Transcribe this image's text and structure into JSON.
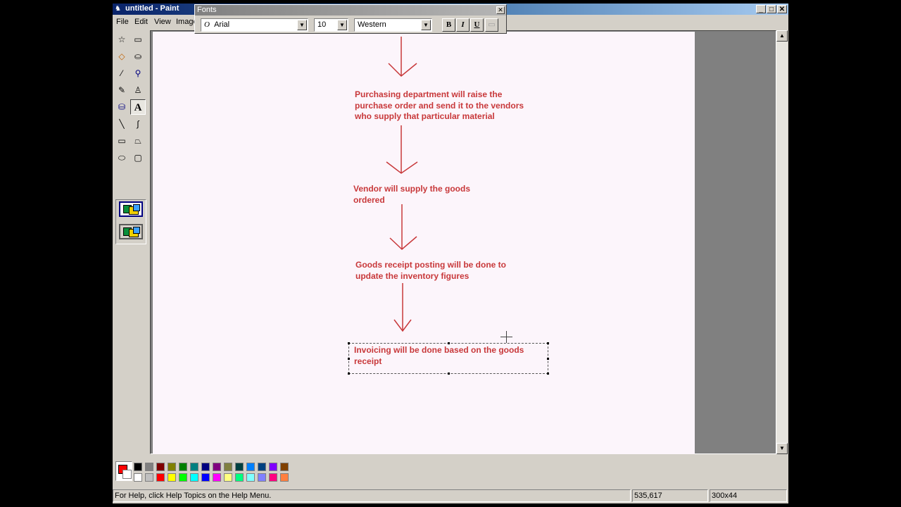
{
  "window": {
    "title": "untitled - Paint",
    "controls": {
      "minimize": "_",
      "maximize": "□",
      "close": "✕"
    }
  },
  "menu": {
    "items": [
      "File",
      "Edit",
      "View",
      "Image"
    ]
  },
  "toolbox": {
    "tools": [
      {
        "name": "free-form-select",
        "glyph": "☆"
      },
      {
        "name": "select",
        "glyph": "▭"
      },
      {
        "name": "eraser",
        "glyph": "◇"
      },
      {
        "name": "fill-with-color",
        "glyph": "⛀"
      },
      {
        "name": "pick-color",
        "glyph": "⁄"
      },
      {
        "name": "magnifier",
        "glyph": "⚲"
      },
      {
        "name": "pencil",
        "glyph": "✎"
      },
      {
        "name": "brush",
        "glyph": "♙"
      },
      {
        "name": "airbrush",
        "glyph": "⛁"
      },
      {
        "name": "text",
        "glyph": "A"
      },
      {
        "name": "line",
        "glyph": "╲"
      },
      {
        "name": "curve",
        "glyph": "∫"
      },
      {
        "name": "rectangle",
        "glyph": "▭"
      },
      {
        "name": "polygon",
        "glyph": "⏢"
      },
      {
        "name": "ellipse",
        "glyph": "⬭"
      },
      {
        "name": "rounded-rectangle",
        "glyph": "▢"
      }
    ],
    "selected_tool": "text"
  },
  "fonts_toolbar": {
    "title": "Fonts",
    "close": "✕",
    "font_icon": "O",
    "font_name": "Arial",
    "font_size": "10",
    "script": "Western",
    "bold": "B",
    "italic": "I",
    "underline": "U",
    "dropdown_glyph": "▼"
  },
  "canvas": {
    "texts": [
      "Purchasing department will raise the\npurchase order and send it to the vendors\nwho supply that particular material",
      "Vendor will supply the goods\nordered",
      "Goods receipt posting will be done to\nupdate the inventory figures",
      "Invoicing will be done based on the goods\nreceipt"
    ],
    "text_color": "#c8383a"
  },
  "scrollbar": {
    "up": "▲",
    "down": "▼"
  },
  "palette": {
    "foreground": "#ff0000",
    "background": "#ffffff",
    "top_row": [
      "#000000",
      "#808080",
      "#800000",
      "#808000",
      "#008000",
      "#008080",
      "#000080",
      "#800080",
      "#808040",
      "#004040",
      "#0080ff",
      "#004080",
      "#8000ff",
      "#804000"
    ],
    "bottom_row": [
      "#ffffff",
      "#c0c0c0",
      "#ff0000",
      "#ffff00",
      "#00ff00",
      "#00ffff",
      "#0000ff",
      "#ff00ff",
      "#ffff80",
      "#00ff80",
      "#80ffff",
      "#8080ff",
      "#ff0080",
      "#ff8040"
    ]
  },
  "status": {
    "help": "For Help, click Help Topics on the Help Menu.",
    "coords": "535,617",
    "size": "300x44"
  }
}
